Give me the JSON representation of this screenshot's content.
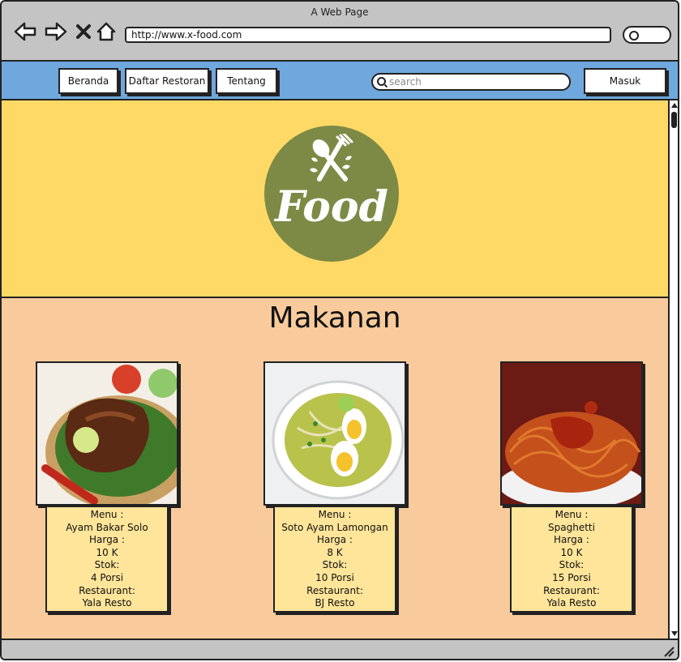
{
  "window": {
    "title": "A Web Page"
  },
  "browser": {
    "url": "http://www.x-food.com"
  },
  "nav": {
    "items": [
      "Beranda",
      "Daftar Restoran",
      "Tentang"
    ],
    "search_placeholder": "search",
    "login_label": "Masuk"
  },
  "hero": {
    "logo_text": "Food"
  },
  "section": {
    "title": "Makanan"
  },
  "foods": [
    {
      "menu_label": "Menu :",
      "menu": "Ayam Bakar Solo",
      "price_label": "Harga :",
      "price": "10 K",
      "stock_label": "Stok:",
      "stock": "4 Porsi",
      "restaurant_label": "Restaurant:",
      "restaurant": "Yala Resto"
    },
    {
      "menu_label": "Menu :",
      "menu": "Soto Ayam Lamongan",
      "price_label": "Harga :",
      "price": "8 K",
      "stock_label": "Stok:",
      "stock": "10 Porsi",
      "restaurant_label": "Restaurant:",
      "restaurant": "BJ Resto"
    },
    {
      "menu_label": "Menu :",
      "menu": "Spaghetti",
      "price_label": "Harga :",
      "price": "10 K",
      "stock_label": "Stok:",
      "stock": "15 Porsi",
      "restaurant_label": "Restaurant:",
      "restaurant": "Yala Resto"
    }
  ],
  "colors": {
    "navbar": "#6fa8dc",
    "hero": "#ffd966",
    "content": "#f9cb9c",
    "info_card": "#ffe599",
    "logo": "#7d8a45"
  }
}
